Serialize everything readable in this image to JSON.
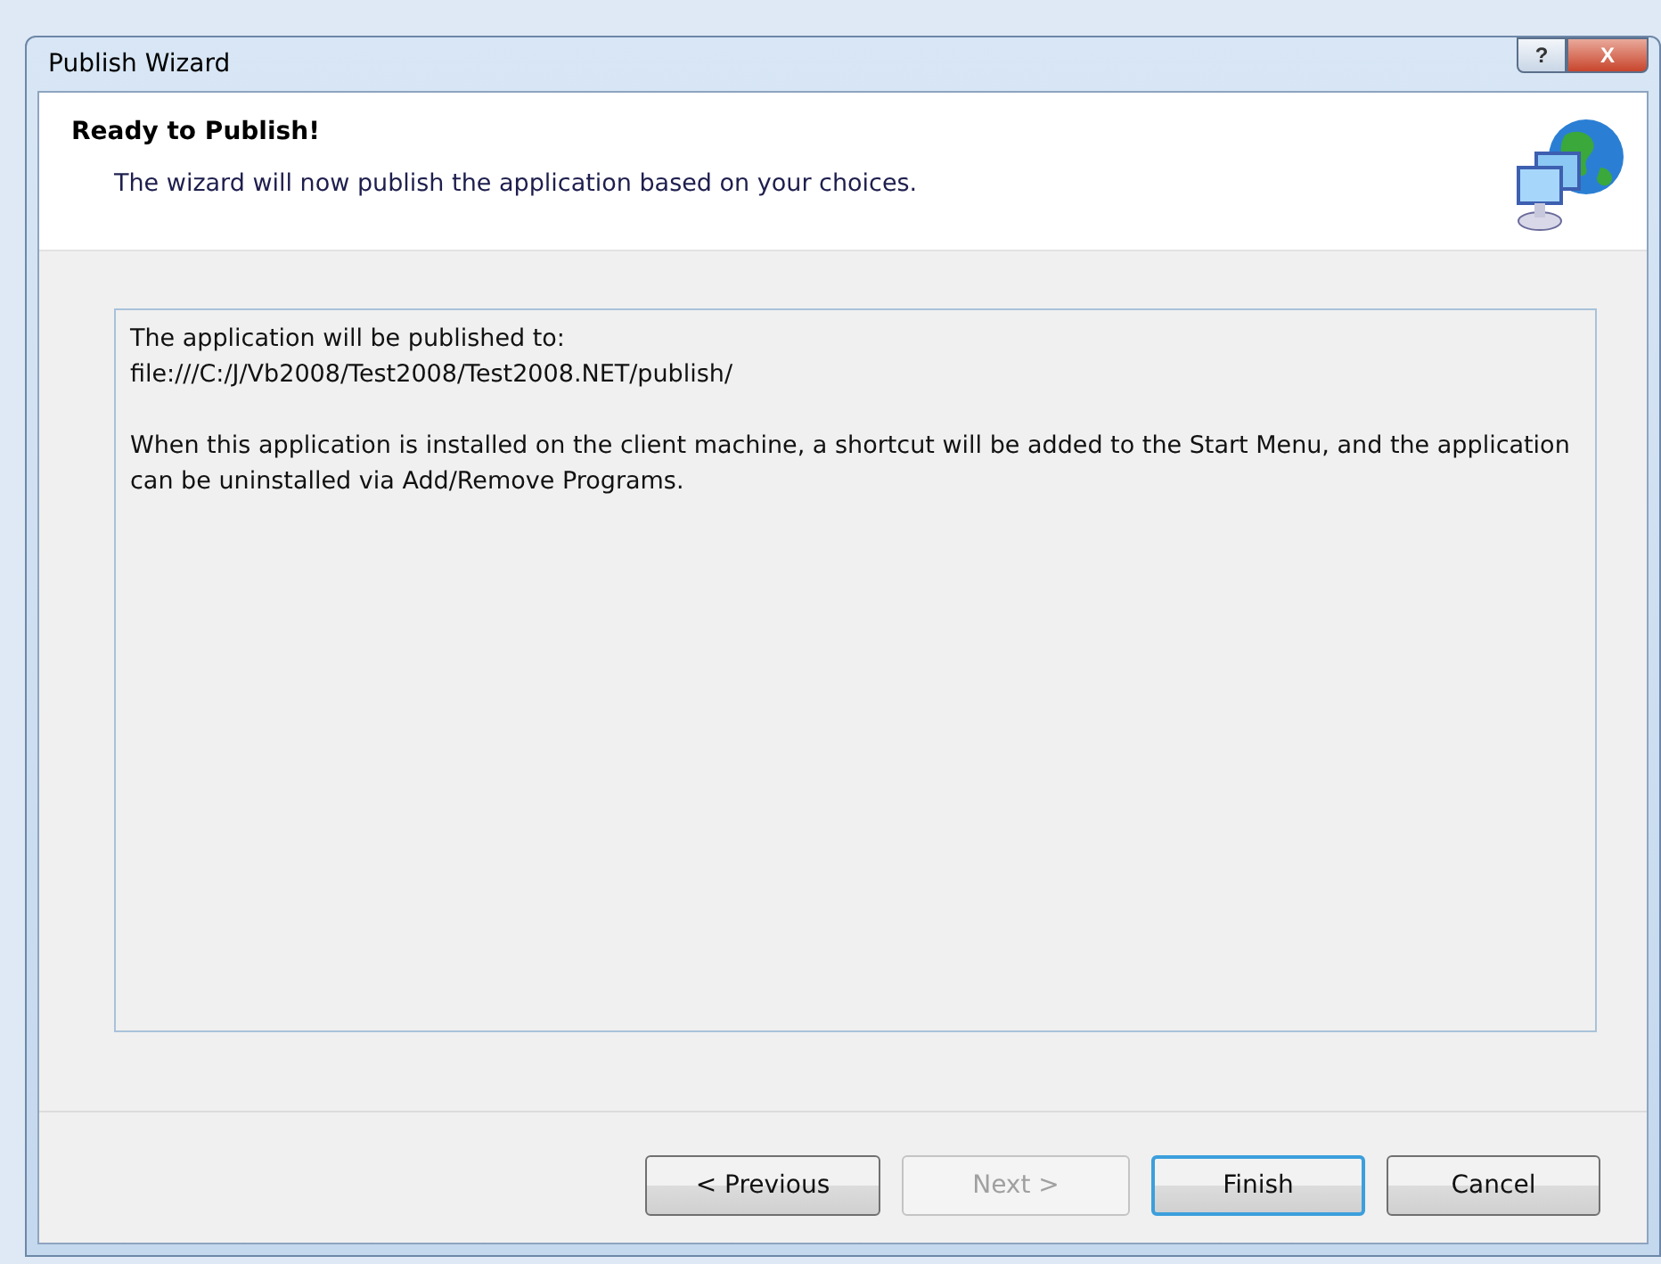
{
  "window": {
    "title": "Publish Wizard",
    "controls": [
      {
        "kind": "help",
        "label": "?"
      },
      {
        "kind": "close",
        "label": "X"
      }
    ]
  },
  "header": {
    "title": "Ready to Publish!",
    "subtitle": "The wizard will now publish the application based on your choices."
  },
  "summary": {
    "paragraphs": [
      {
        "lines": [
          "The application will be published to:",
          "file:///C:/J/Vb2008/Test2008/Test2008.NET/publish/"
        ]
      },
      {
        "lines": [
          "When this application is installed on the client machine, a shortcut will be added to the Start Menu, and the application can be uninstalled via Add/Remove Programs."
        ]
      }
    ]
  },
  "buttons": [
    {
      "label": "< Previous",
      "disabled": false,
      "default": false
    },
    {
      "label": "Next >",
      "disabled": true,
      "default": false
    },
    {
      "label": "Finish",
      "disabled": false,
      "default": true
    },
    {
      "label": "Cancel",
      "disabled": false,
      "default": false
    }
  ]
}
